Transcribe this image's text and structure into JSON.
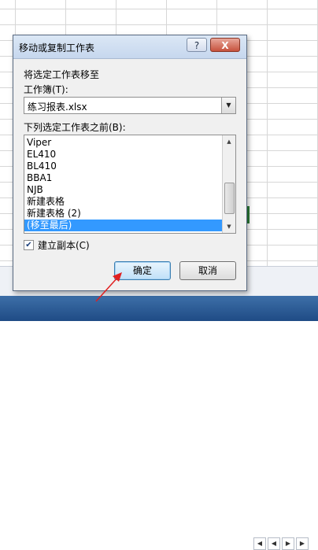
{
  "dialog": {
    "title": "移动或复制工作表",
    "help_label": "?",
    "close_label": "X",
    "move_to_label": "将选定工作表移至",
    "workbook_label": "工作簿(T):",
    "workbook_value": "练习报表.xlsx",
    "before_sheet_label": "下列选定工作表之前(B):",
    "sheets": [
      "Viper",
      "EL410",
      "BL410",
      "BBA1",
      "NJB",
      "新建表格",
      "新建表格 (2)",
      "(移至最后)"
    ],
    "selected_sheet": "(移至最后)",
    "create_copy_label": "建立副本(C)",
    "create_copy_checked": true,
    "ok_label": "确定",
    "cancel_label": "取消"
  },
  "colors": {
    "selection": "#3399ff",
    "annotation_arrow": "#e02020"
  }
}
